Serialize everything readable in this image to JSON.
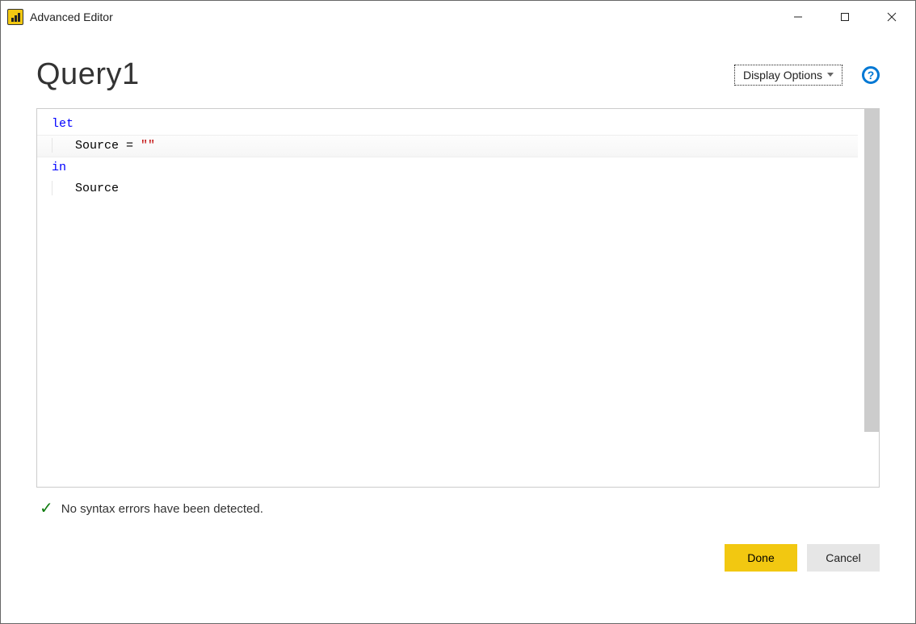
{
  "titlebar": {
    "title": "Advanced Editor"
  },
  "header": {
    "query_name": "Query1",
    "display_options_label": "Display Options",
    "help_glyph": "?"
  },
  "editor": {
    "kw_let": "let",
    "line2_source": "Source = ",
    "line2_string": "\"\"",
    "kw_in": "in",
    "line4_source": "Source"
  },
  "status": {
    "message": "No syntax errors have been detected."
  },
  "footer": {
    "done_label": "Done",
    "cancel_label": "Cancel"
  }
}
